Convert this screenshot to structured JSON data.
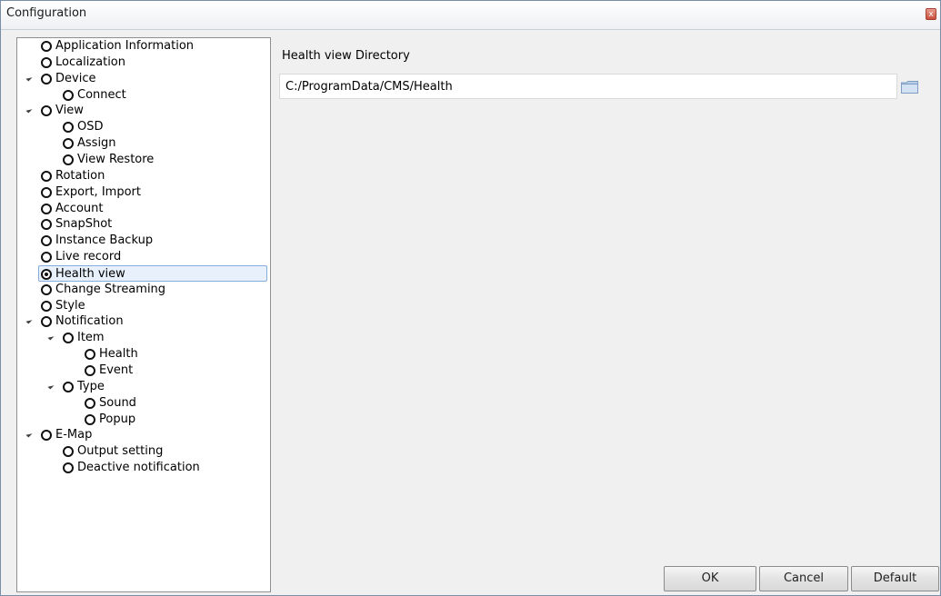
{
  "window": {
    "title": "Configuration",
    "close_symbol": "x"
  },
  "tree": {
    "items": [
      {
        "label": "Application Information",
        "level": 0,
        "expanded": null,
        "checked": false
      },
      {
        "label": "Localization",
        "level": 0,
        "expanded": null,
        "checked": false
      },
      {
        "label": "Device",
        "level": 0,
        "expanded": true,
        "checked": false
      },
      {
        "label": "Connect",
        "level": 1,
        "expanded": null,
        "checked": false
      },
      {
        "label": "View",
        "level": 0,
        "expanded": true,
        "checked": false
      },
      {
        "label": "OSD",
        "level": 1,
        "expanded": null,
        "checked": false
      },
      {
        "label": "Assign",
        "level": 1,
        "expanded": null,
        "checked": false
      },
      {
        "label": "View Restore",
        "level": 1,
        "expanded": null,
        "checked": false
      },
      {
        "label": "Rotation",
        "level": 0,
        "expanded": null,
        "checked": false
      },
      {
        "label": "Export, Import",
        "level": 0,
        "expanded": null,
        "checked": false
      },
      {
        "label": "Account",
        "level": 0,
        "expanded": null,
        "checked": false
      },
      {
        "label": "SnapShot",
        "level": 0,
        "expanded": null,
        "checked": false
      },
      {
        "label": "Instance Backup",
        "level": 0,
        "expanded": null,
        "checked": false
      },
      {
        "label": "Live record",
        "level": 0,
        "expanded": null,
        "checked": false
      },
      {
        "label": "Health view",
        "level": 0,
        "expanded": null,
        "checked": true
      },
      {
        "label": "Change Streaming",
        "level": 0,
        "expanded": null,
        "checked": false
      },
      {
        "label": "Style",
        "level": 0,
        "expanded": null,
        "checked": false
      },
      {
        "label": "Notification",
        "level": 0,
        "expanded": true,
        "checked": false
      },
      {
        "label": "Item",
        "level": 1,
        "expanded": true,
        "checked": false
      },
      {
        "label": "Health",
        "level": 2,
        "expanded": null,
        "checked": false
      },
      {
        "label": "Event",
        "level": 2,
        "expanded": null,
        "checked": false
      },
      {
        "label": "Type",
        "level": 1,
        "expanded": true,
        "checked": false
      },
      {
        "label": "Sound",
        "level": 2,
        "expanded": null,
        "checked": false
      },
      {
        "label": "Popup",
        "level": 2,
        "expanded": null,
        "checked": false
      },
      {
        "label": "E-Map",
        "level": 0,
        "expanded": true,
        "checked": false
      },
      {
        "label": "Output setting",
        "level": 1,
        "expanded": null,
        "checked": false
      },
      {
        "label": "Deactive notification",
        "level": 1,
        "expanded": null,
        "checked": false
      }
    ]
  },
  "content": {
    "section_title": "Health view Directory",
    "directory_value": "C:/ProgramData/CMS/Health"
  },
  "buttons": {
    "ok": "OK",
    "cancel": "Cancel",
    "default": "Default"
  },
  "colors": {
    "selection_bg": "#e8f1fb",
    "selection_border": "#84acdd",
    "dialog_bg": "#f0f0f0"
  }
}
